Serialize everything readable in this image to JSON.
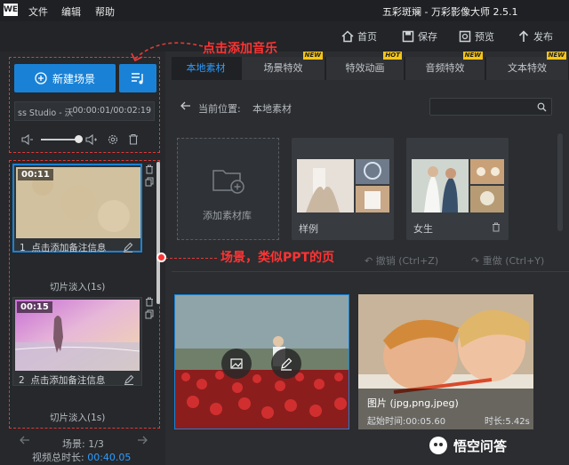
{
  "app": {
    "logo": "WE",
    "menu": [
      "文件",
      "编辑",
      "帮助"
    ],
    "title": "五彩斑斓 - 万彩影像大师 2.5.1"
  },
  "toolbar": {
    "home": "首页",
    "save": "保存",
    "preview": "预览",
    "publish": "发布"
  },
  "left": {
    "new_scene": "新建场景",
    "track_text": "ss Studio - 沃",
    "track_time": "00:00:01/00:02:19",
    "scenes": [
      {
        "duration": "00:11",
        "index": "1",
        "note": "点击添加备注信息",
        "transition": "切片淡入(1s)"
      },
      {
        "duration": "00:15",
        "index": "2",
        "note": "点击添加备注信息",
        "transition": "切片淡入(1s)"
      }
    ],
    "footer_scene": "场景: 1/3",
    "footer_total_label": "视频总时长: ",
    "footer_total_value": "00:40.05"
  },
  "tabs": [
    {
      "label": "本地素材",
      "badge": "",
      "active": true
    },
    {
      "label": "场景特效",
      "badge": "NEW",
      "active": false
    },
    {
      "label": "特效动画",
      "badge": "HOT",
      "active": false
    },
    {
      "label": "音频特效",
      "badge": "NEW",
      "active": false
    },
    {
      "label": "文本特效",
      "badge": "NEW",
      "active": false
    }
  ],
  "pathbar": {
    "label": "当前位置:",
    "value": "本地素材",
    "search_placeholder": ""
  },
  "library": {
    "add": "添加素材库",
    "cards": [
      {
        "label": "样例"
      },
      {
        "label": "女生"
      }
    ]
  },
  "actions": {
    "undo": "撤销 (Ctrl+Z)",
    "redo": "重做 (Ctrl+Y)"
  },
  "media": {
    "item2_title": "图片 (jpg,png,jpeg)",
    "item2_start": "起始时间:00:05.60",
    "item2_length": "时长:5.42s"
  },
  "annotations": {
    "music": "点击添加音乐",
    "scene": "场景，类似PPT的页"
  },
  "watermark": "悟空问答",
  "colors": {
    "accent": "#1a82d6",
    "annotation": "#ff3333",
    "badge": "#f5c518"
  }
}
